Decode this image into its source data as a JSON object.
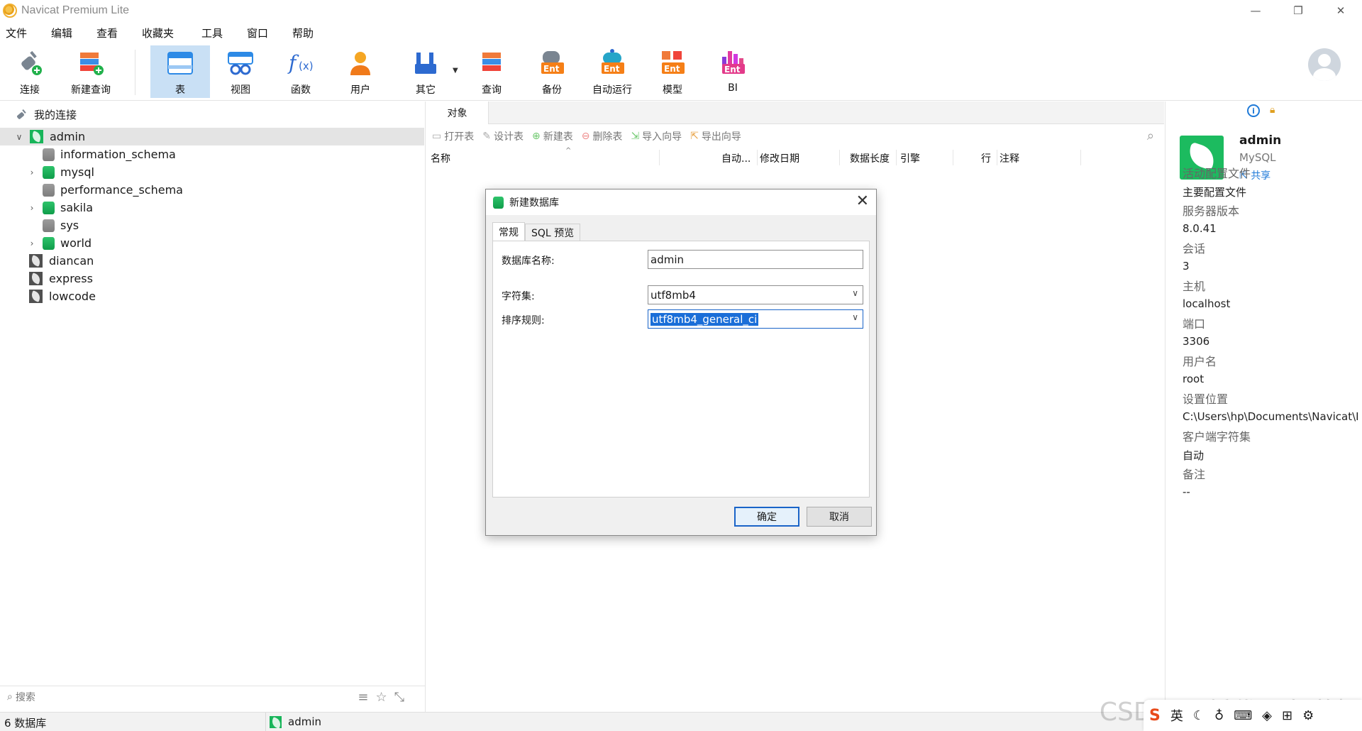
{
  "window": {
    "title": "Navicat Premium Lite",
    "controls": [
      "—",
      "❐",
      "✕"
    ]
  },
  "menu": [
    "文件",
    "编辑",
    "查看",
    "收藏夹",
    "工具",
    "窗口",
    "帮助"
  ],
  "toolbar": {
    "connect": "连接",
    "new_query": "新建查询",
    "table": "表",
    "view": "视图",
    "function": "函数",
    "user": "用户",
    "other": "其它",
    "query": "查询",
    "backup": "备份",
    "automation": "自动运行",
    "model": "模型",
    "bi": "BI",
    "ent_badge": "Ent"
  },
  "sidebar": {
    "header": "我的连接",
    "items": [
      {
        "label": "admin",
        "kind": "connection",
        "expanded": true
      },
      {
        "label": "information_schema",
        "kind": "db-grey"
      },
      {
        "label": "mysql",
        "kind": "db-green"
      },
      {
        "label": "performance_schema",
        "kind": "db-grey"
      },
      {
        "label": "sakila",
        "kind": "db-green"
      },
      {
        "label": "sys",
        "kind": "db-grey"
      },
      {
        "label": "world",
        "kind": "db-green"
      },
      {
        "label": "diancan",
        "kind": "connection-grey"
      },
      {
        "label": "express",
        "kind": "connection-grey"
      },
      {
        "label": "lowcode",
        "kind": "connection-grey"
      }
    ],
    "search_placeholder": "搜索"
  },
  "status": {
    "db_count": "6 数据库",
    "connection": "admin"
  },
  "objects": {
    "tab": "对象",
    "actions": [
      "打开表",
      "设计表",
      "新建表",
      "删除表",
      "导入向导",
      "导出向导"
    ],
    "columns": [
      "名称",
      "自动...",
      "修改日期",
      "数据长度",
      "引擎",
      "行",
      "注释"
    ]
  },
  "info": {
    "name": "admin",
    "type": "MySQL",
    "share": "共享",
    "fields": [
      {
        "k": "活动配置文件",
        "v": "主要配置文件"
      },
      {
        "k": "服务器版本",
        "v": "8.0.41"
      },
      {
        "k": "会话",
        "v": "3"
      },
      {
        "k": "主机",
        "v": "localhost"
      },
      {
        "k": "端口",
        "v": "3306"
      },
      {
        "k": "用户名",
        "v": "root"
      },
      {
        "k": "设置位置",
        "v": "C:\\Users\\hp\\Documents\\Navicat\\I"
      },
      {
        "k": "客户端字符集",
        "v": "自动"
      },
      {
        "k": "备注",
        "v": "--"
      }
    ]
  },
  "dialog": {
    "title": "新建数据库",
    "tabs": [
      "常规",
      "SQL 预览"
    ],
    "db_name_label": "数据库名称:",
    "db_name_value": "admin",
    "charset_label": "字符集:",
    "charset_value": "utf8mb4",
    "collation_label": "排序规则:",
    "collation_value": "utf8mb4_general_ci",
    "ok": "确定",
    "cancel": "取消"
  },
  "watermark": "CSDN @低代码布道师",
  "tray": {
    "ime": "英"
  },
  "colors": {
    "accent": "#1a64c8",
    "active_tool": "#c9e0f5",
    "connection_green": "#18b55a"
  }
}
